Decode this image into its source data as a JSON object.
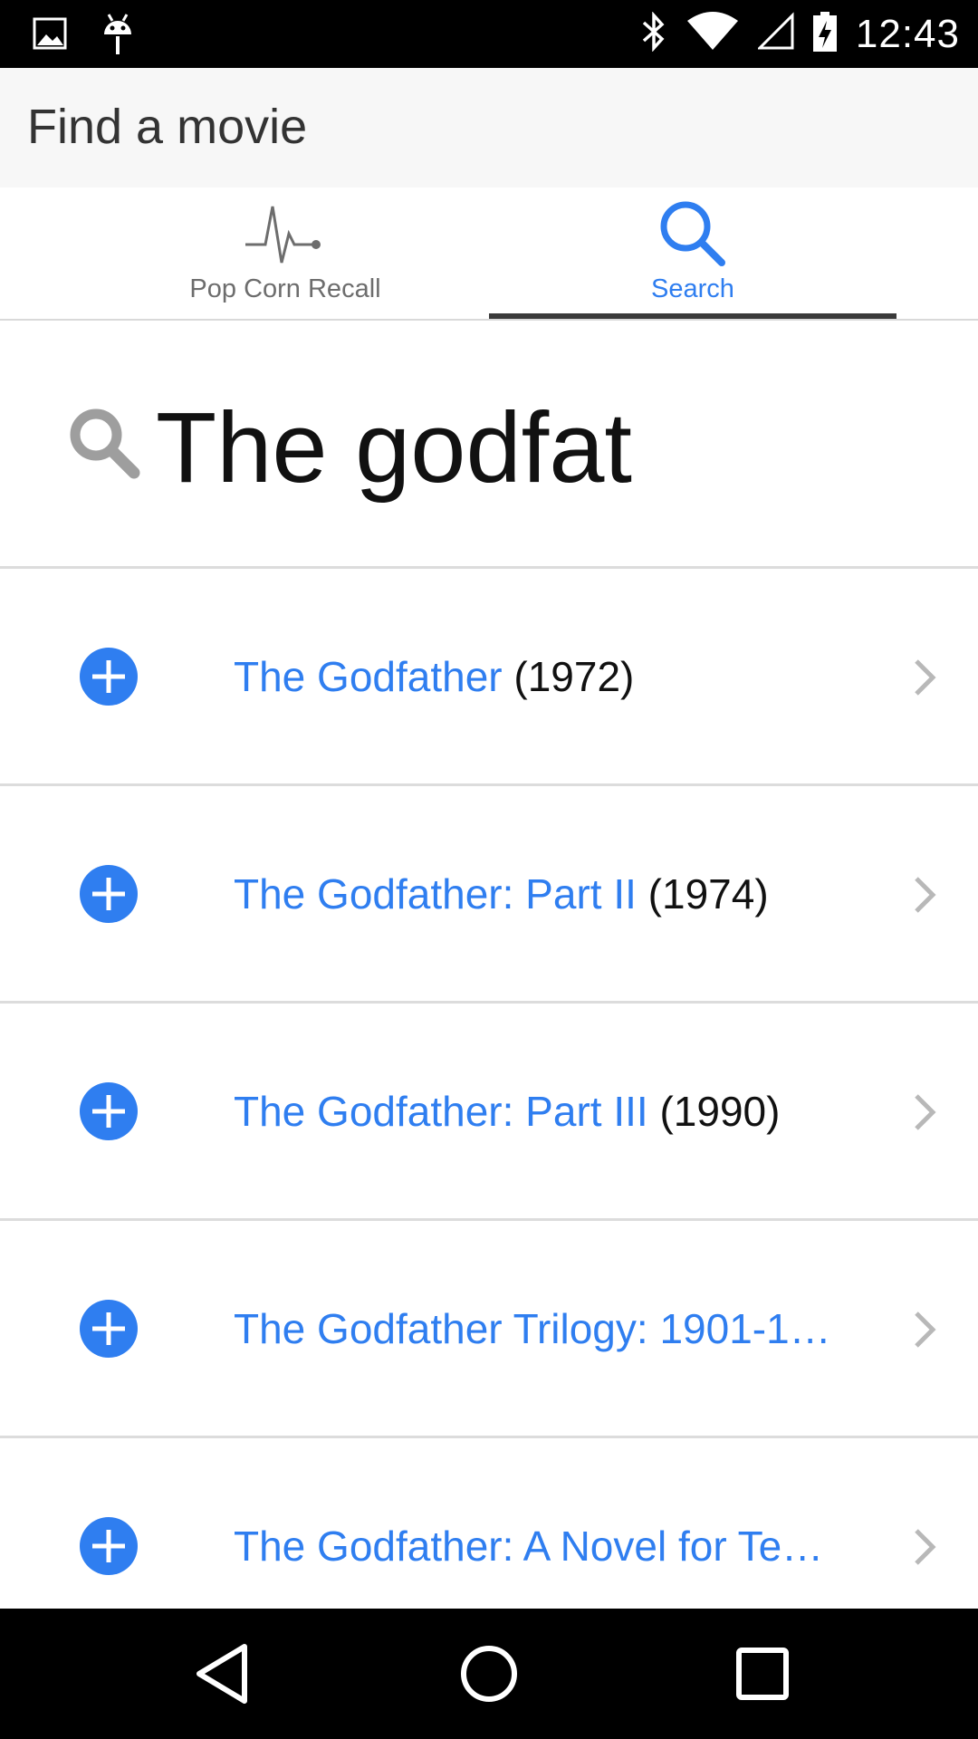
{
  "status_bar": {
    "time": "12:43",
    "icons": [
      "image-icon",
      "android-icon",
      "bluetooth-icon",
      "wifi-icon",
      "cell-signal-icon",
      "battery-charging-icon"
    ]
  },
  "app_bar": {
    "title": "Find a movie"
  },
  "tabs": [
    {
      "label": "Pop Corn Recall",
      "icon": "pulse-icon",
      "selected": false
    },
    {
      "label": "Search",
      "icon": "search-icon",
      "selected": true
    }
  ],
  "search": {
    "value": "The godfat",
    "icon": "search-icon"
  },
  "results": [
    {
      "title": "The Godfather",
      "year": "(1972)"
    },
    {
      "title": "The Godfather: Part II",
      "year": "(1974)"
    },
    {
      "title": "The Godfather: Part III",
      "year": "(1990)"
    },
    {
      "title": "The Godfather Trilogy: 1901-1…",
      "year": ""
    },
    {
      "title": "The Godfather: A Novel for Te…",
      "year": ""
    }
  ],
  "nav_bar": {
    "icons": [
      "back-icon",
      "home-icon",
      "recents-icon"
    ]
  },
  "colors": {
    "accent": "#2f7ef0",
    "title_text": "#333333",
    "divider": "#dcdcdc"
  }
}
